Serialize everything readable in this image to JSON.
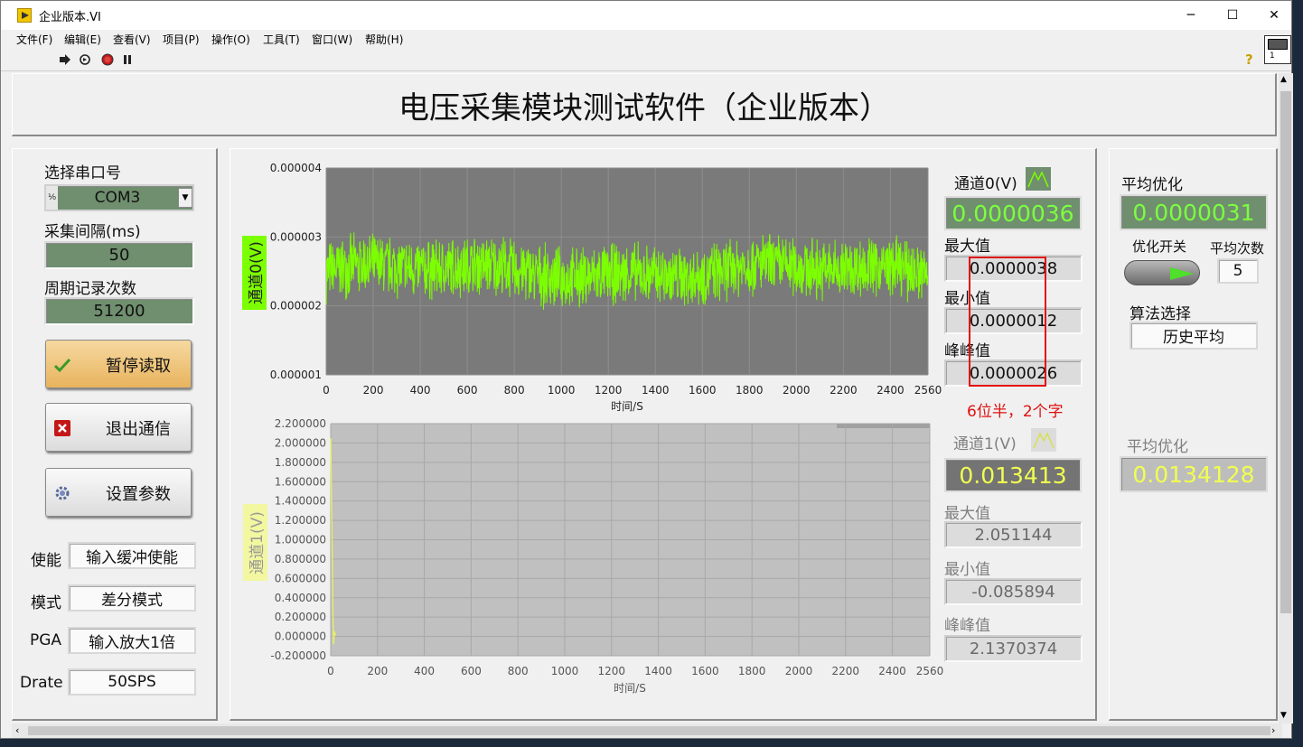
{
  "window": {
    "title": "企业版本.VI",
    "minimize": "─",
    "maximize": "☐",
    "close": "✕"
  },
  "menu": [
    "文件(F)",
    "编辑(E)",
    "查看(V)",
    "项目(P)",
    "操作(O)",
    "工具(T)",
    "窗口(W)",
    "帮助(H)"
  ],
  "toolbar": {
    "help": "?",
    "vi_icon_number": "1"
  },
  "main_title": "电压采集模块测试软件（企业版本）",
  "left": {
    "serial_label": "选择串口号",
    "serial_value": "COM3",
    "serial_prefix": "⅟₀",
    "interval_label": "采集间隔(ms)",
    "interval_value": "50",
    "period_label": "周期记录次数",
    "period_value": "51200",
    "buttons": {
      "pause": "暂停读取",
      "exit": "退出通信",
      "settings": "设置参数"
    },
    "config": [
      {
        "label": "使能",
        "value": "输入缓冲使能"
      },
      {
        "label": "模式",
        "value": "差分模式"
      },
      {
        "label": "PGA",
        "value": "输入放大1倍"
      },
      {
        "label": "Drate",
        "value": "50SPS"
      }
    ]
  },
  "ch0": {
    "legend": "通道0(V)",
    "value": "0.0000036",
    "max_label": "最大值",
    "max": "0.0000038",
    "min_label": "最小值",
    "min": "0.0000012",
    "pp_label": "峰峰值",
    "pp": "0.0000026"
  },
  "annotation": "6位半，2个字",
  "ch1": {
    "legend": "通道1(V)",
    "value": "0.013413",
    "max_label": "最大值",
    "max": "2.051144",
    "min_label": "最小值",
    "min": "-0.085894",
    "pp_label": "峰峰值",
    "pp": "2.1370374"
  },
  "right": {
    "avg_label": "平均优化",
    "avg_value": "0.0000031",
    "opt_switch_label": "优化开关",
    "avg_count_label": "平均次数",
    "avg_count": "5",
    "algo_label": "算法选择",
    "algo_value": "历史平均",
    "avg2_label": "平均优化",
    "avg2_value": "0.0134128"
  },
  "chart_data": [
    {
      "type": "line",
      "ylabel": "通道0(V)",
      "xlabel": "时间/S",
      "xlim": [
        0,
        2560
      ],
      "ylim": [
        1e-06,
        4e-06
      ],
      "xticks": [
        "0",
        "200",
        "400",
        "600",
        "800",
        "1000",
        "1200",
        "1400",
        "1600",
        "1800",
        "2000",
        "2200",
        "2400",
        "2560"
      ],
      "yticks": [
        "0.000004",
        "0.000003",
        "0.000002",
        "0.000001"
      ],
      "series": [
        {
          "color": "#7cff00",
          "mean": 2.5e-06,
          "spread": 5e-07
        }
      ]
    },
    {
      "type": "line",
      "ylabel": "通道1(V)",
      "xlabel": "时间/S",
      "xlim": [
        0,
        2560
      ],
      "ylim": [
        -0.2,
        2.2
      ],
      "xticks": [
        "0",
        "200",
        "400",
        "600",
        "800",
        "1000",
        "1200",
        "1400",
        "1600",
        "1800",
        "2000",
        "2200",
        "2400",
        "2560"
      ],
      "yticks": [
        "2.200000",
        "2.000000",
        "1.800000",
        "1.600000",
        "1.400000",
        "1.200000",
        "1.000000",
        "0.800000",
        "0.600000",
        "0.400000",
        "0.200000",
        "0.000000",
        "-0.200000"
      ],
      "series": [
        {
          "color": "#e8f060",
          "points": [
            [
              0,
              2.05
            ],
            [
              3,
              1.4
            ],
            [
              6,
              0.9
            ],
            [
              9,
              0.3
            ],
            [
              12,
              -0.08
            ],
            [
              16,
              0.05
            ],
            [
              20,
              0.0134
            ]
          ]
        }
      ]
    }
  ]
}
